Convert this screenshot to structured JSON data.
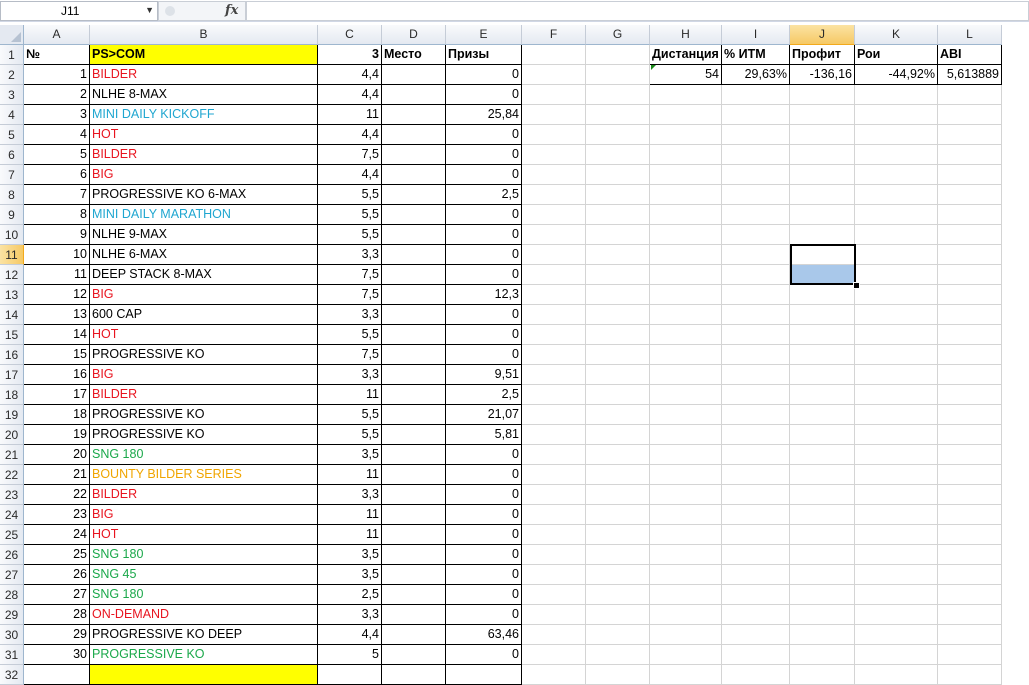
{
  "formula_bar": {
    "name_box": "J11",
    "fx": "fx",
    "formula": ""
  },
  "columns": [
    "A",
    "B",
    "C",
    "D",
    "E",
    "F",
    "G",
    "H",
    "I",
    "J",
    "K",
    "L"
  ],
  "selected_column": "J",
  "selected_row": 11,
  "colors": {
    "red": "#e8141f",
    "cyan": "#1fa6d0",
    "green": "#1aa84a",
    "orange": "#f0a500",
    "black": "#000000"
  },
  "header_row": {
    "a": "№",
    "b": "PS>COM",
    "c": "3",
    "d": "Место",
    "e": "Призы"
  },
  "stats_headers": {
    "h": "Дистанция",
    "i": "% ИТМ",
    "j": "Профит",
    "k": "Рои",
    "l": "ABI"
  },
  "stats_values": {
    "h": "54",
    "i": "29,63%",
    "j": "-136,16",
    "k": "-44,92%",
    "l": "5,613889"
  },
  "rows": [
    {
      "n": "1",
      "name": "BILDER",
      "color": "red",
      "buyin": "4,4",
      "prize": "0"
    },
    {
      "n": "2",
      "name": "NLHE 8-MAX",
      "color": "black",
      "buyin": "4,4",
      "prize": "0"
    },
    {
      "n": "3",
      "name": "MINI DAILY KICKOFF",
      "color": "cyan",
      "buyin": "11",
      "prize": "25,84"
    },
    {
      "n": "4",
      "name": "HOT",
      "color": "red",
      "buyin": "4,4",
      "prize": "0"
    },
    {
      "n": "5",
      "name": "BILDER",
      "color": "red",
      "buyin": "7,5",
      "prize": "0"
    },
    {
      "n": "6",
      "name": "BIG",
      "color": "red",
      "buyin": "4,4",
      "prize": "0"
    },
    {
      "n": "7",
      "name": "PROGRESSIVE KO 6-MAX",
      "color": "black",
      "buyin": "5,5",
      "prize": "2,5"
    },
    {
      "n": "8",
      "name": "MINI DAILY MARATHON",
      "color": "cyan",
      "buyin": "5,5",
      "prize": "0"
    },
    {
      "n": "9",
      "name": "NLHE 9-MAX",
      "color": "black",
      "buyin": "5,5",
      "prize": "0"
    },
    {
      "n": "10",
      "name": "NLHE 6-MAX",
      "color": "black",
      "buyin": "3,3",
      "prize": "0"
    },
    {
      "n": "11",
      "name": "DEEP STACK 8-MAX",
      "color": "black",
      "buyin": "7,5",
      "prize": "0"
    },
    {
      "n": "12",
      "name": "BIG",
      "color": "red",
      "buyin": "7,5",
      "prize": "12,3"
    },
    {
      "n": "13",
      "name": "600 CAP",
      "color": "black",
      "buyin": "3,3",
      "prize": "0"
    },
    {
      "n": "14",
      "name": "HOT",
      "color": "red",
      "buyin": "5,5",
      "prize": "0"
    },
    {
      "n": "15",
      "name": "PROGRESSIVE KO",
      "color": "black",
      "buyin": "7,5",
      "prize": "0"
    },
    {
      "n": "16",
      "name": "BIG",
      "color": "red",
      "buyin": "3,3",
      "prize": "9,51"
    },
    {
      "n": "17",
      "name": "BILDER",
      "color": "red",
      "buyin": "11",
      "prize": "2,5"
    },
    {
      "n": "18",
      "name": "PROGRESSIVE KO",
      "color": "black",
      "buyin": "5,5",
      "prize": "21,07"
    },
    {
      "n": "19",
      "name": "PROGRESSIVE KO",
      "color": "black",
      "buyin": "5,5",
      "prize": "5,81"
    },
    {
      "n": "20",
      "name": "SNG 180",
      "color": "green",
      "buyin": "3,5",
      "prize": "0"
    },
    {
      "n": "21",
      "name": "BOUNTY BILDER SERIES",
      "color": "orange",
      "buyin": "11",
      "prize": "0"
    },
    {
      "n": "22",
      "name": "BILDER",
      "color": "red",
      "buyin": "3,3",
      "prize": "0"
    },
    {
      "n": "23",
      "name": "BIG",
      "color": "red",
      "buyin": "11",
      "prize": "0"
    },
    {
      "n": "24",
      "name": "HOT",
      "color": "red",
      "buyin": "11",
      "prize": "0"
    },
    {
      "n": "25",
      "name": "SNG 180",
      "color": "green",
      "buyin": "3,5",
      "prize": "0"
    },
    {
      "n": "26",
      "name": "SNG 45",
      "color": "green",
      "buyin": "3,5",
      "prize": "0"
    },
    {
      "n": "27",
      "name": "SNG 180",
      "color": "green",
      "buyin": "2,5",
      "prize": "0"
    },
    {
      "n": "28",
      "name": "ON-DEMAND",
      "color": "red",
      "buyin": "3,3",
      "prize": "0"
    },
    {
      "n": "29",
      "name": "PROGRESSIVE KO DEEP",
      "color": "black",
      "buyin": "4,4",
      "prize": "63,46"
    },
    {
      "n": "30",
      "name": "PROGRESSIVE KO",
      "color": "green",
      "buyin": "5",
      "prize": "0"
    }
  ]
}
